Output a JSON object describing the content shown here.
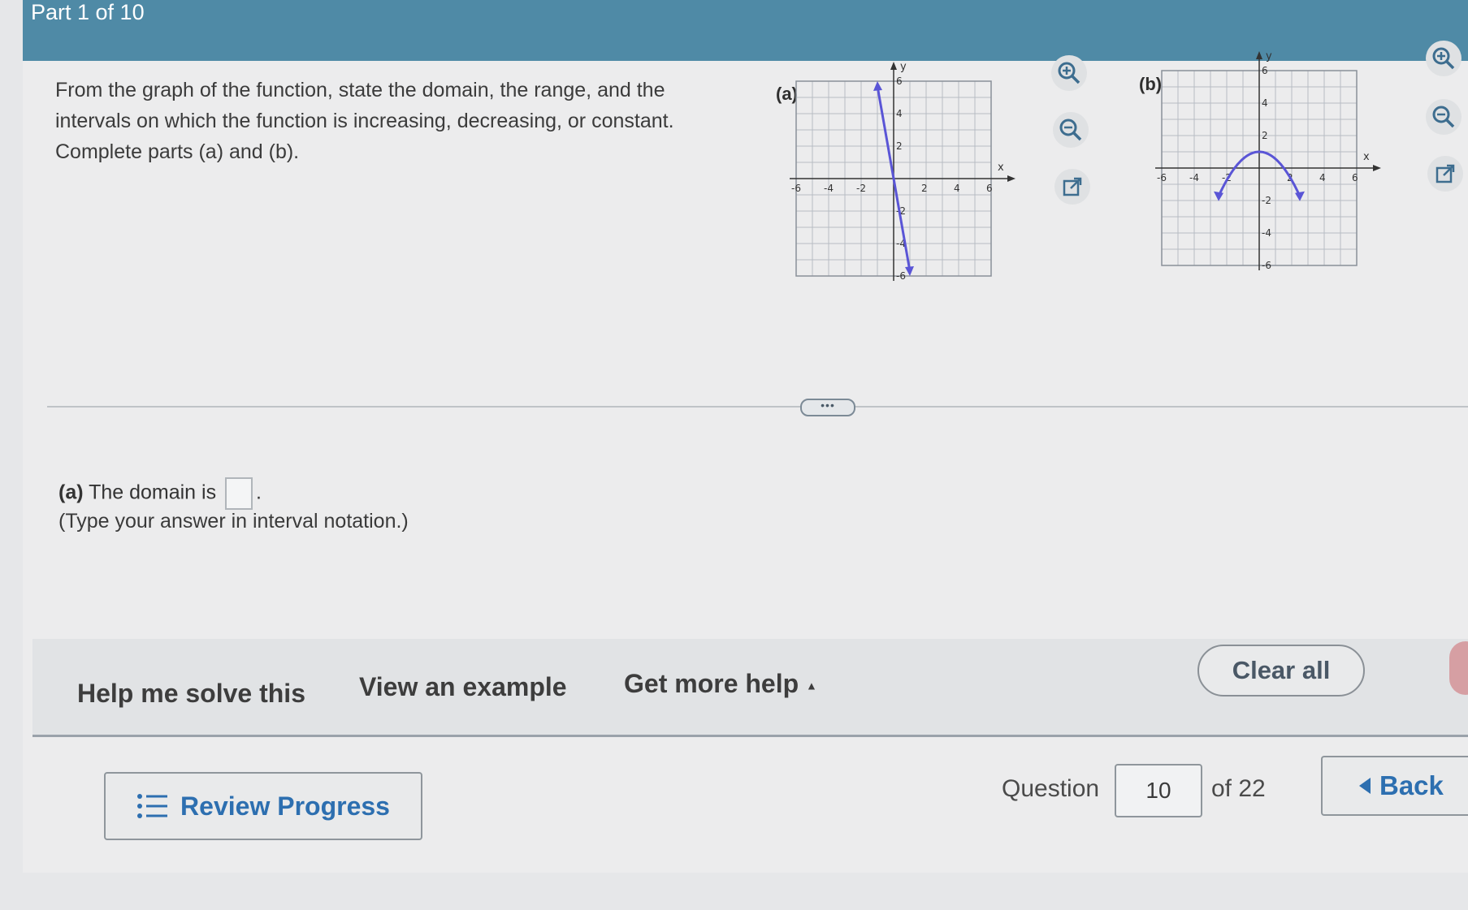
{
  "header": {
    "part_label": "Part 1 of 10"
  },
  "question": {
    "prompt": "From the graph of the function, state the domain, the range, and the intervals on which the function is increasing, decreasing, or constant. Complete parts (a) and (b)."
  },
  "graphs": [
    {
      "label": "(a)",
      "x_axis_label": "x",
      "y_axis_label": "y",
      "x_ticks": [
        "-6",
        "-4",
        "-2",
        "2",
        "4",
        "6"
      ],
      "y_ticks": [
        "6",
        "4",
        "2",
        "-2",
        "-4",
        "-6"
      ],
      "description": "line through (-1,6) and (1,-6)",
      "curve_color": "#5a55d6"
    },
    {
      "label": "(b)",
      "x_axis_label": "x",
      "y_axis_label": "y",
      "x_ticks": [
        "-6",
        "-4",
        "-2",
        "2",
        "4",
        "6"
      ],
      "y_ticks": [
        "6",
        "4",
        "2",
        "-2",
        "-4",
        "-6"
      ],
      "description": "downward parabola vertex (0,1)",
      "curve_color": "#5a55d6"
    }
  ],
  "tools": {
    "icons": [
      "zoom-in-icon",
      "zoom-out-icon",
      "popout-icon"
    ]
  },
  "answer": {
    "part_label": "(a)",
    "text_before": "The domain is",
    "text_after": ".",
    "input_value": "",
    "hint": "(Type your answer in interval notation.)"
  },
  "help_bar": {
    "help_me": "Help me solve this",
    "view_example": "View an example",
    "more_help": "Get more help",
    "more_help_arrow": "▲",
    "clear_all": "Clear all"
  },
  "footer": {
    "review_progress": "Review Progress",
    "question_label": "Question",
    "question_number": "10",
    "question_total": "of 22",
    "back": "Back"
  },
  "colors": {
    "header": "#4f8aa6",
    "accent_blue": "#2d6fb0",
    "curve": "#5a55d6"
  }
}
